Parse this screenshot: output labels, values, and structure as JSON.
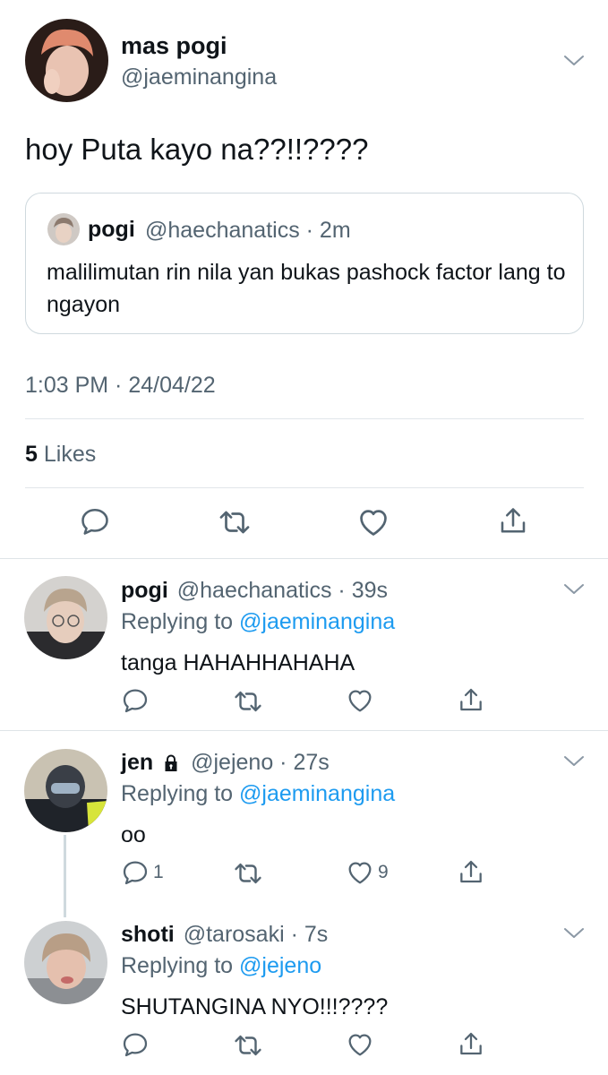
{
  "main_tweet": {
    "display_name": "mas pogi",
    "handle": "@jaeminangina",
    "text": "hoy Puta kayo na??!!????",
    "quote": {
      "display_name": "pogi",
      "handle_time": "@haechanatics · 2m",
      "text": "malilimutan rin nila yan bukas pashock factor lang to ngayon"
    },
    "timestamp": "1:03 PM · 24/04/22",
    "likes_count": "5",
    "likes_label": "Likes",
    "actions": [
      "reply-icon",
      "retweet-icon",
      "like-icon",
      "share-icon"
    ]
  },
  "replies": [
    {
      "display_name": "pogi",
      "handle_time": "@haechanatics · 39s",
      "replying_prefix": "Replying to ",
      "replying_to": "@jaeminangina",
      "text": "tanga HAHAHHAHAHA",
      "reply_count": "",
      "like_count": ""
    },
    {
      "display_name": "jen",
      "protected": true,
      "handle_time": "@jejeno · 27s",
      "replying_prefix": "Replying to ",
      "replying_to": "@jaeminangina",
      "text": "oo",
      "reply_count": "1",
      "like_count": "9"
    },
    {
      "display_name": "shoti",
      "handle_time": "@tarosaki · 7s",
      "replying_prefix": "Replying to ",
      "replying_to": "@jejeno",
      "text": "SHUTANGINA NYO!!!????",
      "reply_count": "",
      "like_count": ""
    }
  ],
  "colors": {
    "text_primary": "#0f1419",
    "text_secondary": "#536471",
    "link": "#1d9bf0",
    "border": "#cfd9de"
  }
}
